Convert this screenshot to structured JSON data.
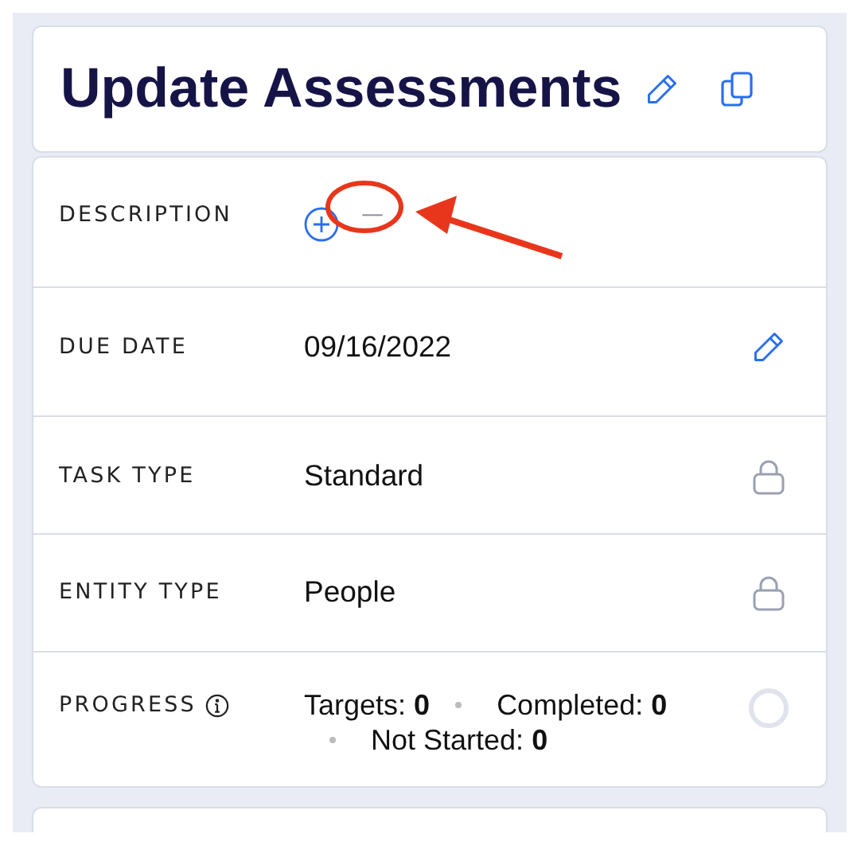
{
  "header": {
    "title": "Update Assessments"
  },
  "fields": [
    {
      "label": "DESCRIPTION",
      "kind": "add",
      "value": "—",
      "editable": false,
      "locked": false
    },
    {
      "label": "DUE DATE",
      "kind": "text",
      "value": "09/16/2022",
      "editable": true,
      "locked": false
    },
    {
      "label": "TASK TYPE",
      "kind": "text",
      "value": "Standard",
      "editable": false,
      "locked": true
    },
    {
      "label": "ENTITY TYPE",
      "kind": "text",
      "value": "People",
      "editable": false,
      "locked": true
    },
    {
      "label": "PROGRESS",
      "kind": "stats",
      "info": true,
      "editable": false,
      "locked": false,
      "stats": [
        {
          "label": "Targets:",
          "value": "0"
        },
        {
          "label": "Completed:",
          "value": "0"
        },
        {
          "label": "Not Started:",
          "value": "0"
        }
      ]
    }
  ]
}
